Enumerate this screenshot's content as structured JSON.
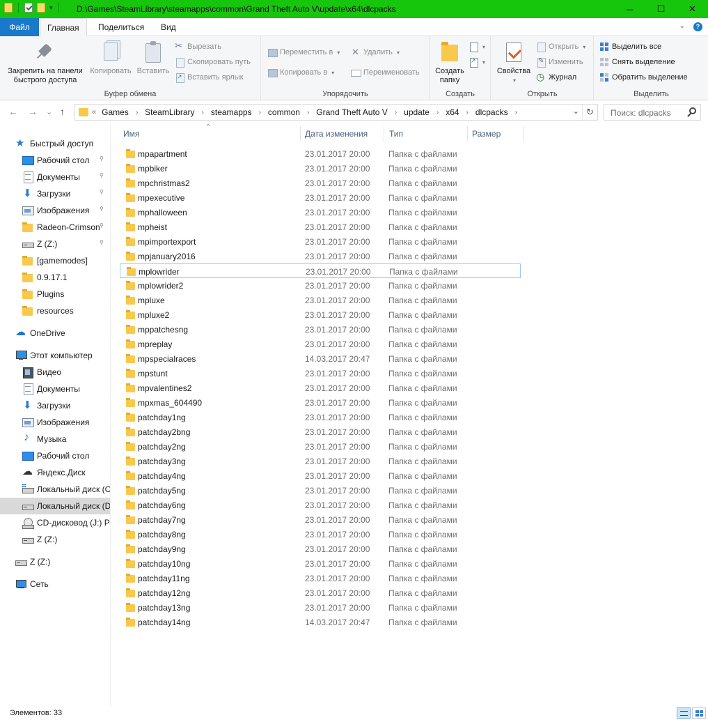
{
  "window": {
    "title": "D:\\Games\\SteamLibrary\\steamapps\\common\\Grand Theft Auto V\\update\\x64\\dlcpacks",
    "controls": {
      "minimize": "─",
      "maximize": "☐",
      "close": "✕"
    },
    "accent_color": "#16c60c"
  },
  "ribbon_tabs": {
    "file": "Файл",
    "home": "Главная",
    "share": "Поделиться",
    "view": "Вид",
    "help": "?",
    "collapse": "⌄"
  },
  "ribbon": {
    "clipboard": {
      "label": "Буфер обмена",
      "pin_line1": "Закрепить на панели",
      "pin_line2": "быстрого доступа",
      "copy": "Копировать",
      "paste": "Вставить",
      "cut": "Вырезать",
      "copy_path": "Скопировать путь",
      "paste_shortcut": "Вставить ярлык"
    },
    "organize": {
      "label": "Упорядочить",
      "move_to": "Переместить в",
      "copy_to": "Копировать в",
      "delete": "Удалить",
      "rename": "Переименовать"
    },
    "new": {
      "label": "Создать",
      "new_folder_line1": "Создать",
      "new_folder_line2": "папку"
    },
    "open": {
      "label": "Открыть",
      "properties": "Свойства",
      "open": "Открыть",
      "edit": "Изменить",
      "history": "Журнал"
    },
    "select": {
      "label": "Выделить",
      "select_all": "Выделить все",
      "select_none": "Снять выделение",
      "invert": "Обратить выделение"
    }
  },
  "address": {
    "lead": "«",
    "crumbs": [
      "Games",
      "SteamLibrary",
      "steamapps",
      "common",
      "Grand Theft Auto V",
      "update",
      "x64",
      "dlcpacks"
    ],
    "search_placeholder": "Поиск: dlcpacks"
  },
  "nav_buttons": {
    "back": "←",
    "forward": "→",
    "recent": "⌄",
    "up": "↑",
    "refresh": "↻",
    "dropdown": "⌄"
  },
  "navigation": {
    "items": [
      {
        "label": "Быстрый доступ",
        "icon": "star-icon",
        "pinned": false,
        "selected": false
      },
      {
        "label": "Рабочий стол",
        "icon": "desktop-icon",
        "pinned": true,
        "selected": false
      },
      {
        "label": "Документы",
        "icon": "documents-icon",
        "pinned": true,
        "selected": false
      },
      {
        "label": "Загрузки",
        "icon": "download-icon",
        "pinned": true,
        "selected": false
      },
      {
        "label": "Изображения",
        "icon": "pictures-icon",
        "pinned": true,
        "selected": false
      },
      {
        "label": "Radeon-Crimson",
        "icon": "folder-icon",
        "pinned": true,
        "selected": false
      },
      {
        "label": "Z (Z:)",
        "icon": "drive-icon",
        "pinned": true,
        "selected": false
      },
      {
        "label": "[gamemodes]",
        "icon": "folder-icon",
        "pinned": false,
        "selected": false
      },
      {
        "label": "0.9.17.1",
        "icon": "folder-icon",
        "pinned": false,
        "selected": false
      },
      {
        "label": "Plugins",
        "icon": "folder-icon",
        "pinned": false,
        "selected": false
      },
      {
        "label": "resources",
        "icon": "folder-icon",
        "pinned": false,
        "selected": false
      },
      {
        "label": "OneDrive",
        "icon": "onedrive-icon",
        "pinned": false,
        "selected": false
      },
      {
        "label": "Этот компьютер",
        "icon": "computer-icon",
        "pinned": false,
        "selected": false
      },
      {
        "label": "Видео",
        "icon": "video-icon",
        "pinned": false,
        "selected": false
      },
      {
        "label": "Документы",
        "icon": "documents-icon",
        "pinned": false,
        "selected": false
      },
      {
        "label": "Загрузки",
        "icon": "download-icon",
        "pinned": false,
        "selected": false
      },
      {
        "label": "Изображения",
        "icon": "pictures-icon",
        "pinned": false,
        "selected": false
      },
      {
        "label": "Музыка",
        "icon": "music-icon",
        "pinned": false,
        "selected": false
      },
      {
        "label": "Рабочий стол",
        "icon": "desktop-icon",
        "pinned": false,
        "selected": false
      },
      {
        "label": "Яндекс.Диск",
        "icon": "yandex-disk-icon",
        "pinned": false,
        "selected": false
      },
      {
        "label": "Локальный диск (C:)",
        "icon": "system-drive-icon",
        "pinned": false,
        "selected": false
      },
      {
        "label": "Локальный диск (D:)",
        "icon": "drive-icon",
        "pinned": false,
        "selected": true
      },
      {
        "label": "CD-дисковод (J:) PS",
        "icon": "cd-drive-icon",
        "pinned": false,
        "selected": false
      },
      {
        "label": "Z (Z:)",
        "icon": "drive-icon",
        "pinned": false,
        "selected": false
      },
      {
        "label": "Z (Z:)",
        "icon": "drive-icon",
        "pinned": false,
        "selected": false
      },
      {
        "label": "Сеть",
        "icon": "network-icon",
        "pinned": false,
        "selected": false
      }
    ]
  },
  "file_list": {
    "columns": {
      "name": "Имя",
      "modified": "Дата изменения",
      "type": "Тип",
      "size": "Размер"
    },
    "rows": [
      {
        "name": "mpapartment",
        "modified": "23.01.2017 20:00",
        "type": "Папка с файлами"
      },
      {
        "name": "mpbiker",
        "modified": "23.01.2017 20:00",
        "type": "Папка с файлами"
      },
      {
        "name": "mpchristmas2",
        "modified": "23.01.2017 20:00",
        "type": "Папка с файлами"
      },
      {
        "name": "mpexecutive",
        "modified": "23.01.2017 20:00",
        "type": "Папка с файлами"
      },
      {
        "name": "mphalloween",
        "modified": "23.01.2017 20:00",
        "type": "Папка с файлами"
      },
      {
        "name": "mpheist",
        "modified": "23.01.2017 20:00",
        "type": "Папка с файлами"
      },
      {
        "name": "mpimportexport",
        "modified": "23.01.2017 20:00",
        "type": "Папка с файлами"
      },
      {
        "name": "mpjanuary2016",
        "modified": "23.01.2017 20:00",
        "type": "Папка с файлами"
      },
      {
        "name": "mplowrider",
        "modified": "23.01.2017 20:00",
        "type": "Папка с файлами"
      },
      {
        "name": "mplowrider2",
        "modified": "23.01.2017 20:00",
        "type": "Папка с файлами"
      },
      {
        "name": "mpluxe",
        "modified": "23.01.2017 20:00",
        "type": "Папка с файлами"
      },
      {
        "name": "mpluxe2",
        "modified": "23.01.2017 20:00",
        "type": "Папка с файлами"
      },
      {
        "name": "mppatchesng",
        "modified": "23.01.2017 20:00",
        "type": "Папка с файлами"
      },
      {
        "name": "mpreplay",
        "modified": "23.01.2017 20:00",
        "type": "Папка с файлами"
      },
      {
        "name": "mpspecialraces",
        "modified": "14.03.2017 20:47",
        "type": "Папка с файлами"
      },
      {
        "name": "mpstunt",
        "modified": "23.01.2017 20:00",
        "type": "Папка с файлами"
      },
      {
        "name": "mpvalentines2",
        "modified": "23.01.2017 20:00",
        "type": "Папка с файлами"
      },
      {
        "name": "mpxmas_604490",
        "modified": "23.01.2017 20:00",
        "type": "Папка с файлами"
      },
      {
        "name": "patchday1ng",
        "modified": "23.01.2017 20:00",
        "type": "Папка с файлами"
      },
      {
        "name": "patchday2bng",
        "modified": "23.01.2017 20:00",
        "type": "Папка с файлами"
      },
      {
        "name": "patchday2ng",
        "modified": "23.01.2017 20:00",
        "type": "Папка с файлами"
      },
      {
        "name": "patchday3ng",
        "modified": "23.01.2017 20:00",
        "type": "Папка с файлами"
      },
      {
        "name": "patchday4ng",
        "modified": "23.01.2017 20:00",
        "type": "Папка с файлами"
      },
      {
        "name": "patchday5ng",
        "modified": "23.01.2017 20:00",
        "type": "Папка с файлами"
      },
      {
        "name": "patchday6ng",
        "modified": "23.01.2017 20:00",
        "type": "Папка с файлами"
      },
      {
        "name": "patchday7ng",
        "modified": "23.01.2017 20:00",
        "type": "Папка с файлами"
      },
      {
        "name": "patchday8ng",
        "modified": "23.01.2017 20:00",
        "type": "Папка с файлами"
      },
      {
        "name": "patchday9ng",
        "modified": "23.01.2017 20:00",
        "type": "Папка с файлами"
      },
      {
        "name": "patchday10ng",
        "modified": "23.01.2017 20:00",
        "type": "Папка с файлами"
      },
      {
        "name": "patchday11ng",
        "modified": "23.01.2017 20:00",
        "type": "Папка с файлами"
      },
      {
        "name": "patchday12ng",
        "modified": "23.01.2017 20:00",
        "type": "Папка с файлами"
      },
      {
        "name": "patchday13ng",
        "modified": "23.01.2017 20:00",
        "type": "Папка с файлами"
      },
      {
        "name": "patchday14ng",
        "modified": "14.03.2017 20:47",
        "type": "Папка с файлами"
      }
    ],
    "focused_row": "mplowrider"
  },
  "status": {
    "items_count": "Элементов: 33"
  }
}
